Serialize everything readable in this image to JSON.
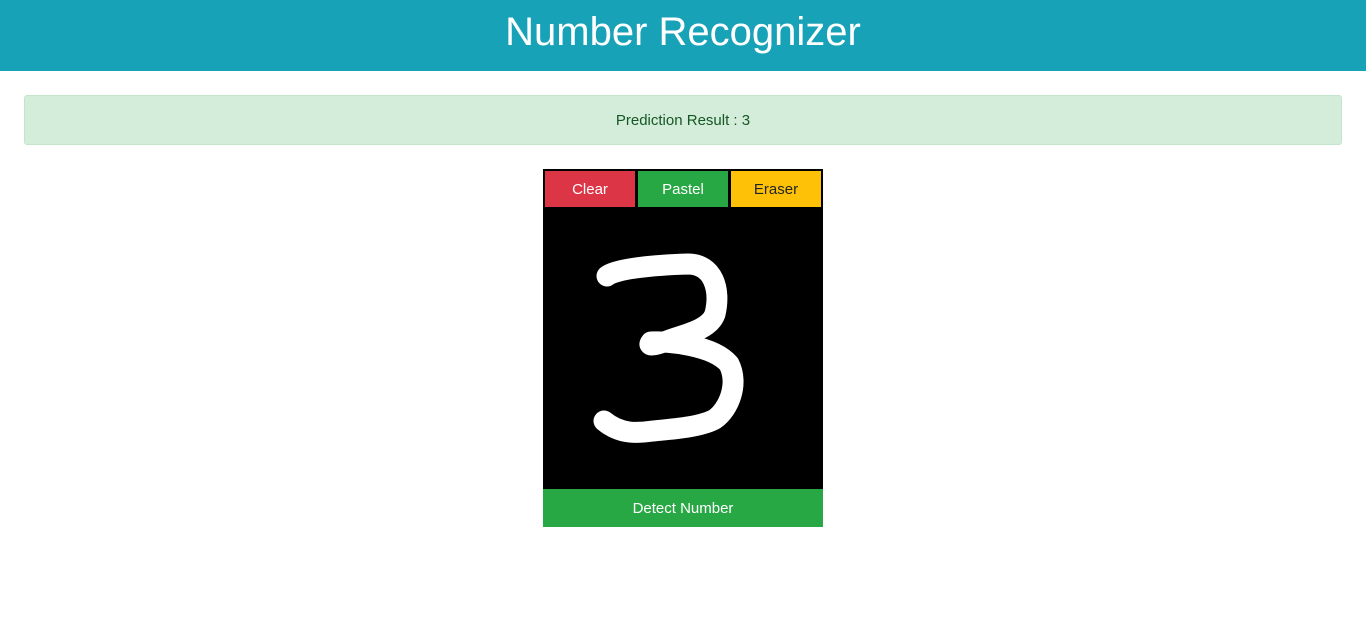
{
  "header": {
    "title": "Number Recognizer"
  },
  "result": {
    "label": "Prediction Result :",
    "value": "3"
  },
  "toolbar": {
    "clear_label": "Clear",
    "pastel_label": "Pastel",
    "eraser_label": "Eraser"
  },
  "drawing": {
    "digit_drawn": "3",
    "stroke_color": "#ffffff",
    "background_color": "#000000"
  },
  "actions": {
    "detect_label": "Detect Number"
  },
  "colors": {
    "header": "#17a2b8",
    "alert_bg": "#d4edda",
    "alert_text": "#155724",
    "clear": "#dc3545",
    "pastel": "#28a745",
    "eraser": "#ffc107",
    "detect": "#28a745"
  }
}
